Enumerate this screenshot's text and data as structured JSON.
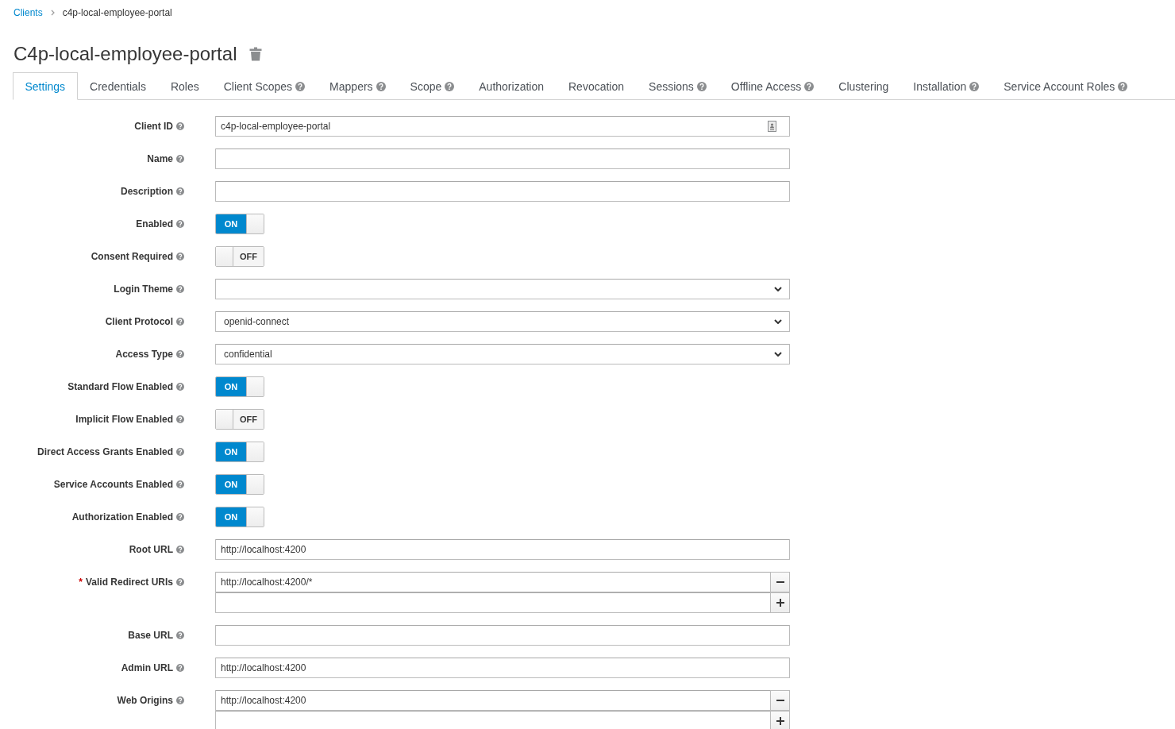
{
  "breadcrumb": [
    {
      "kind": "link",
      "label": "Clients"
    },
    {
      "kind": "current",
      "label": "c4p-local-employee-portal"
    }
  ],
  "header": {
    "title": "C4p-local-employee-portal"
  },
  "tabs": [
    {
      "label": "Settings",
      "selected": true,
      "help": false
    },
    {
      "label": "Credentials",
      "selected": false,
      "help": false
    },
    {
      "label": "Roles",
      "selected": false,
      "help": false
    },
    {
      "label": "Client Scopes",
      "selected": false,
      "help": true
    },
    {
      "label": "Mappers",
      "selected": false,
      "help": true
    },
    {
      "label": "Scope",
      "selected": false,
      "help": true
    },
    {
      "label": "Authorization",
      "selected": false,
      "help": false
    },
    {
      "label": "Revocation",
      "selected": false,
      "help": false
    },
    {
      "label": "Sessions",
      "selected": false,
      "help": true
    },
    {
      "label": "Offline Access",
      "selected": false,
      "help": true
    },
    {
      "label": "Clustering",
      "selected": false,
      "help": false
    },
    {
      "label": "Installation",
      "selected": false,
      "help": true
    },
    {
      "label": "Service Account Roles",
      "selected": false,
      "help": true
    }
  ],
  "form": {
    "fields": [
      {
        "kind": "text",
        "label": "Client ID",
        "value": "c4p-local-employee-portal",
        "autofill_icon": true
      },
      {
        "kind": "text",
        "label": "Name",
        "autofill_icon": false
      },
      {
        "kind": "text",
        "label": "Description",
        "autofill_icon": false
      },
      {
        "kind": "toggle",
        "label": "Enabled",
        "on": true,
        "switch_text": "ON"
      },
      {
        "kind": "toggle",
        "label": "Consent Required",
        "on": false,
        "switch_text": "OFF"
      },
      {
        "kind": "select",
        "label": "Login Theme"
      },
      {
        "kind": "select",
        "label": "Client Protocol",
        "value": "openid-connect"
      },
      {
        "kind": "select",
        "label": "Access Type",
        "value": "confidential"
      },
      {
        "kind": "toggle",
        "label": "Standard Flow Enabled",
        "on": true,
        "switch_text": "ON"
      },
      {
        "kind": "toggle",
        "label": "Implicit Flow Enabled",
        "on": false,
        "switch_text": "OFF"
      },
      {
        "kind": "toggle",
        "label": "Direct Access Grants Enabled",
        "on": true,
        "switch_text": "ON"
      },
      {
        "kind": "toggle",
        "label": "Service Accounts Enabled",
        "on": true,
        "switch_text": "ON"
      },
      {
        "kind": "toggle",
        "label": "Authorization Enabled",
        "on": true,
        "switch_text": "ON"
      },
      {
        "kind": "text",
        "label": "Root URL",
        "value": "http://localhost:4200",
        "autofill_icon": false
      },
      {
        "kind": "multi",
        "label": "Valid Redirect URIs",
        "required_mark": "*",
        "values": [
          "http://localhost:4200/*"
        ]
      },
      {
        "kind": "text",
        "label": "Base URL",
        "autofill_icon": false
      },
      {
        "kind": "text",
        "label": "Admin URL",
        "value": "http://localhost:4200",
        "autofill_icon": false
      },
      {
        "kind": "multi",
        "label": "Web Origins",
        "values": [
          "http://localhost:4200"
        ]
      }
    ]
  }
}
